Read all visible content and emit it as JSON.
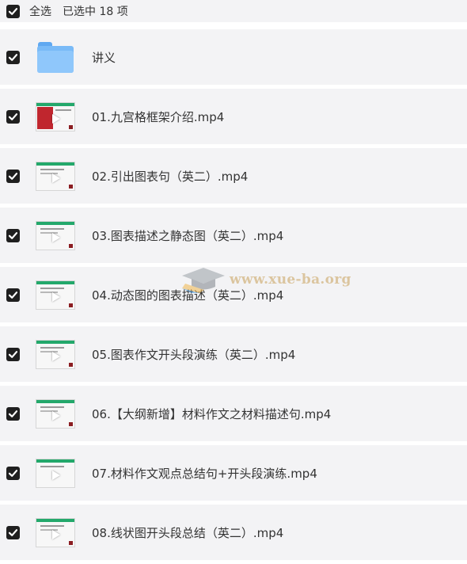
{
  "header": {
    "select_all_label": "全选",
    "selected_count": "已选中  18  项"
  },
  "items": [
    {
      "name": "讲义",
      "kind": "folder",
      "checked": true
    },
    {
      "name": "01.九宫格框架介绍.mp4",
      "kind": "video",
      "checked": true
    },
    {
      "name": "02.引出图表句（英二）.mp4",
      "kind": "video",
      "checked": true
    },
    {
      "name": "03.图表描述之静态图（英二）.mp4",
      "kind": "video",
      "checked": true
    },
    {
      "name": "04.动态图的图表描述（英二）.mp4",
      "kind": "video",
      "checked": true
    },
    {
      "name": "05.图表作文开头段演练（英二）.mp4",
      "kind": "video",
      "checked": true
    },
    {
      "name": "06.【大纲新增】材料作文之材料描述句.mp4",
      "kind": "video",
      "checked": true
    },
    {
      "name": "07.材料作文观点总结句+开头段演练.mp4",
      "kind": "video",
      "checked": true
    },
    {
      "name": "08.线状图开头段总结（英二）.mp4",
      "kind": "video",
      "checked": true
    }
  ],
  "watermark": {
    "text": "www.xue-ba.org"
  },
  "icons": {
    "checkbox": "checkbox-checked-icon",
    "folder": "folder-icon",
    "video": "video-thumbnail"
  },
  "colors": {
    "row_background": "#f3f3f5",
    "checkbox": "#1f1f1f",
    "folder": "#79baf7",
    "thumb_band": "#23a86b"
  }
}
